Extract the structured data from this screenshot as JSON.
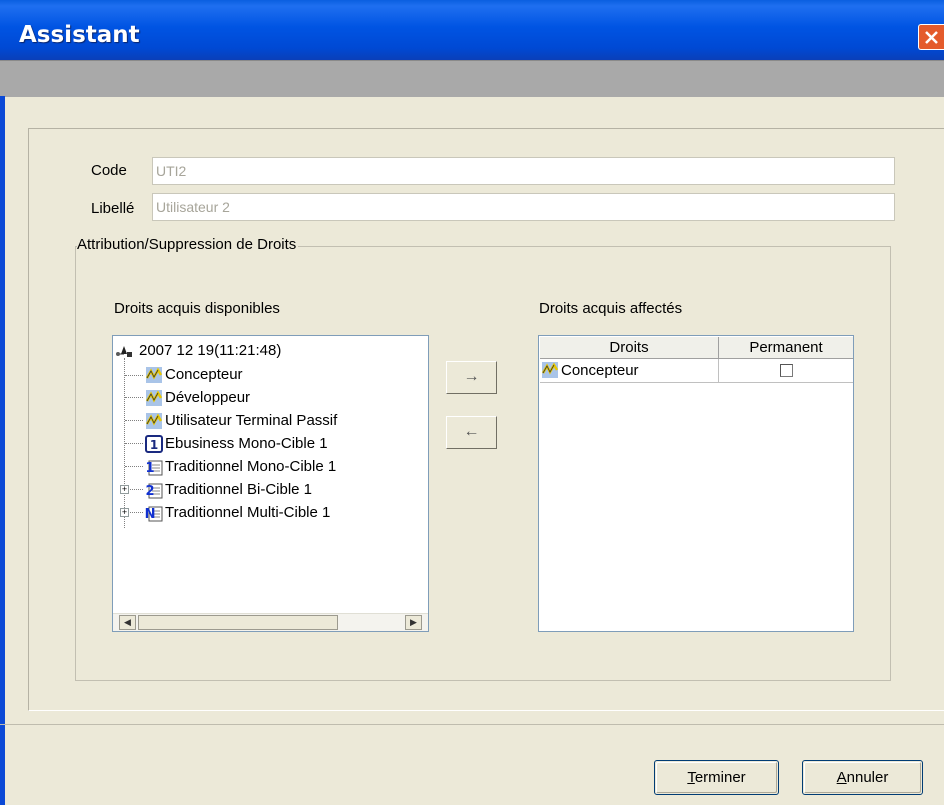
{
  "window": {
    "title": "Assistant"
  },
  "form": {
    "code_label": "Code",
    "code_value": "UTI2",
    "libelle_label": "Libellé",
    "libelle_value": "Utilisateur 2"
  },
  "group": {
    "legend": "Attribution/Suppression de Droits"
  },
  "available": {
    "header": "Droits acquis disponibles",
    "root": {
      "label": "2007 12 19(11:21:48)",
      "icon": "tree-root-icon"
    },
    "items": [
      {
        "label": "Concepteur",
        "icon": "role-icon",
        "expandable": false
      },
      {
        "label": "Développeur",
        "icon": "role-icon",
        "expandable": false
      },
      {
        "label": "Utilisateur Terminal Passif",
        "icon": "role-icon",
        "expandable": false
      },
      {
        "label": "Ebusiness Mono-Cible 1",
        "icon": "ebusiness-mono-icon",
        "expandable": false
      },
      {
        "label": "Traditionnel Mono-Cible 1",
        "icon": "mono-cible-icon",
        "expandable": false
      },
      {
        "label": "Traditionnel Bi-Cible 1",
        "icon": "bi-cible-icon",
        "expandable": true
      },
      {
        "label": "Traditionnel Multi-Cible 1",
        "icon": "multi-cible-icon",
        "expandable": true
      }
    ]
  },
  "transfer": {
    "add_glyph": "→",
    "remove_glyph": "←"
  },
  "assigned": {
    "header": "Droits acquis affectés",
    "columns": [
      "Droits",
      "Permanent"
    ],
    "rows": [
      {
        "droit": "Concepteur",
        "permanent": false
      }
    ]
  },
  "buttons": {
    "finish_mnemonic": "T",
    "finish_rest": "erminer",
    "cancel_mnemonic": "A",
    "cancel_rest": "nnuler"
  },
  "colors": {
    "title_blue": "#0054e3",
    "face": "#ece9d8",
    "close_red": "#e45b2c"
  }
}
